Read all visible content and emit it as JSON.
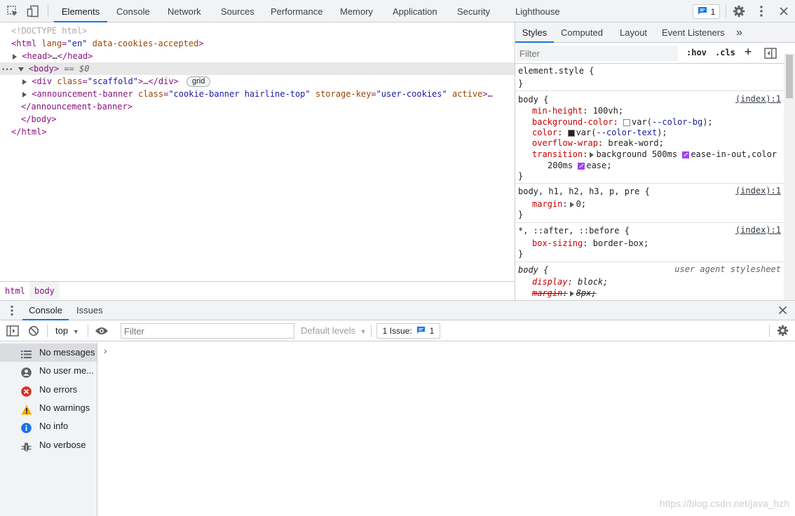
{
  "toolbar": {
    "tabs": [
      "Elements",
      "Console",
      "Network",
      "Sources",
      "Performance",
      "Memory",
      "Application",
      "Security",
      "Lighthouse"
    ],
    "active_tab": "Elements",
    "issues_count": "1",
    "icons": [
      "inspect-icon",
      "device-toggle-icon",
      "gear-icon",
      "kebab-menu-icon",
      "close-icon"
    ]
  },
  "dom": {
    "doctype": "<!DOCTYPE html>",
    "html_open": "<html",
    "html_attr1_name": "lang",
    "html_attr1_value": "\"en\"",
    "html_attr2_name": "data-cookies-accepted",
    "html_open_end": ">",
    "head": "<head>",
    "head_ellipsis": "…",
    "head_close": "</head>",
    "body_dots": "•••",
    "body_open": "<body>",
    "body_marker": "== $0",
    "div_open": "<div",
    "div_attr_name": "class",
    "div_attr_value": "\"scaffold\"",
    "div_rest": ">…</div>",
    "grid_badge": "grid",
    "banner_open": "<announcement-banner",
    "banner_attr1_name": "class",
    "banner_attr1_value": "\"cookie-banner hairline-top\"",
    "banner_attr2_name": "storage-key",
    "banner_attr2_value": "\"user-cookies\"",
    "banner_attr3_name": "active",
    "banner_rest": ">…",
    "banner_close": "</announcement-banner>",
    "body_close": "</body>",
    "html_close": "</html>"
  },
  "breadcrumb": [
    "html",
    "body"
  ],
  "styles": {
    "tabs": [
      "Styles",
      "Computed",
      "Layout",
      "Event Listeners"
    ],
    "more_tabs_glyph": "»",
    "active_tab": "Styles",
    "filter_placeholder": "Filter",
    "hov": ":hov",
    "cls": ".cls",
    "plus": "+",
    "rules": {
      "element_style": {
        "selector": "element.style {",
        "close": "}"
      },
      "body": {
        "selector": "body {",
        "source": "(index):1",
        "p1_name": "min-height",
        "p1_value": "100vh;",
        "p2_name": "background-color",
        "p2_pre": "var(",
        "p2_var": "--color-bg",
        "p2_post": ");",
        "p3_name": "color",
        "p3_pre": "var(",
        "p3_var": "--color-text",
        "p3_post": ");",
        "p4_name": "overflow-wrap",
        "p4_value": "break-word;",
        "p5_name": "transition",
        "p5_value_a": "background 500ms",
        "p5_value_b": "ease-in-out,color",
        "p5_value_c": "200ms",
        "p5_value_d": "ease;",
        "close": "}"
      },
      "body_h": {
        "selector": "body, h1, h2, h3, p, pre {",
        "source": "(index):1",
        "p1_name": "margin",
        "p1_value": "0;",
        "close": "}"
      },
      "universal": {
        "selector": "*, ::after, ::before {",
        "source": "(index):1",
        "p1_name": "box-sizing",
        "p1_value": "border-box;",
        "close": "}"
      },
      "ua_body": {
        "selector": "body {",
        "source": "user agent stylesheet",
        "p1_name": "display",
        "p1_value": "block;",
        "p2_name": "margin",
        "p2_value": "8px;"
      }
    }
  },
  "drawer": {
    "tabs": [
      "Console",
      "Issues"
    ],
    "active_tab": "Console"
  },
  "console": {
    "context": "top",
    "filter_placeholder": "Filter",
    "levels": "Default levels",
    "issue_label": "1 Issue:",
    "issue_count": "1",
    "sidebar": [
      {
        "label": "No messages",
        "icon": "list-icon",
        "color": "#5f6368"
      },
      {
        "label": "No user me...",
        "icon": "user-icon",
        "color": "#5f6368"
      },
      {
        "label": "No errors",
        "icon": "error-icon",
        "color": "#d93025"
      },
      {
        "label": "No warnings",
        "icon": "warning-icon",
        "color": "#f9ab00"
      },
      {
        "label": "No info",
        "icon": "info-icon",
        "color": "#1a73e8"
      },
      {
        "label": "No verbose",
        "icon": "bug-icon",
        "color": "#5f6368"
      }
    ],
    "prompt": "›"
  },
  "watermark": "https://blog.csdn.net/java_hzh",
  "colors": {
    "accent": "#1a73e8",
    "tag": "#881280",
    "attr": "#994500",
    "value": "#1a1aa6",
    "prop": "#c80000"
  }
}
